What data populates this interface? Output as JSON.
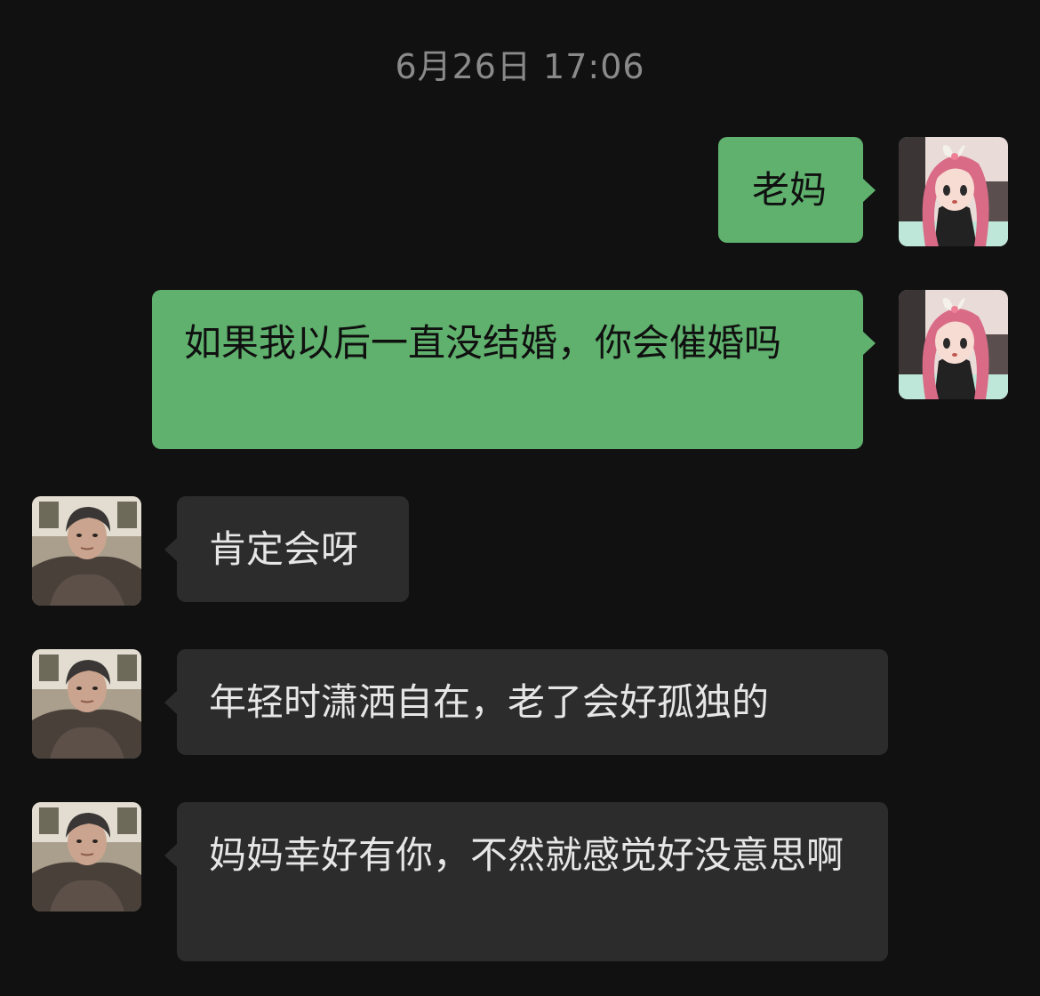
{
  "chat": {
    "timestamp": "6月26日 17:06",
    "messages": [
      {
        "sender": "me",
        "avatar_icon": "anime-girl-avatar",
        "text": "老妈"
      },
      {
        "sender": "me",
        "avatar_icon": "anime-girl-avatar",
        "text": "如果我以后一直没结婚，你会催婚吗"
      },
      {
        "sender": "mom",
        "avatar_icon": "mom-photo-avatar",
        "text": "肯定会呀"
      },
      {
        "sender": "mom",
        "avatar_icon": "mom-photo-avatar",
        "text": "年轻时潇洒自在，老了会好孤独的"
      },
      {
        "sender": "mom",
        "avatar_icon": "mom-photo-avatar",
        "text": "妈妈幸好有你，不然就感觉好没意思啊"
      }
    ]
  },
  "colors": {
    "background": "#111111",
    "outgoing_bubble": "#5fb16d",
    "incoming_bubble": "#2c2c2c",
    "timestamp_text": "#8a8a8a"
  }
}
